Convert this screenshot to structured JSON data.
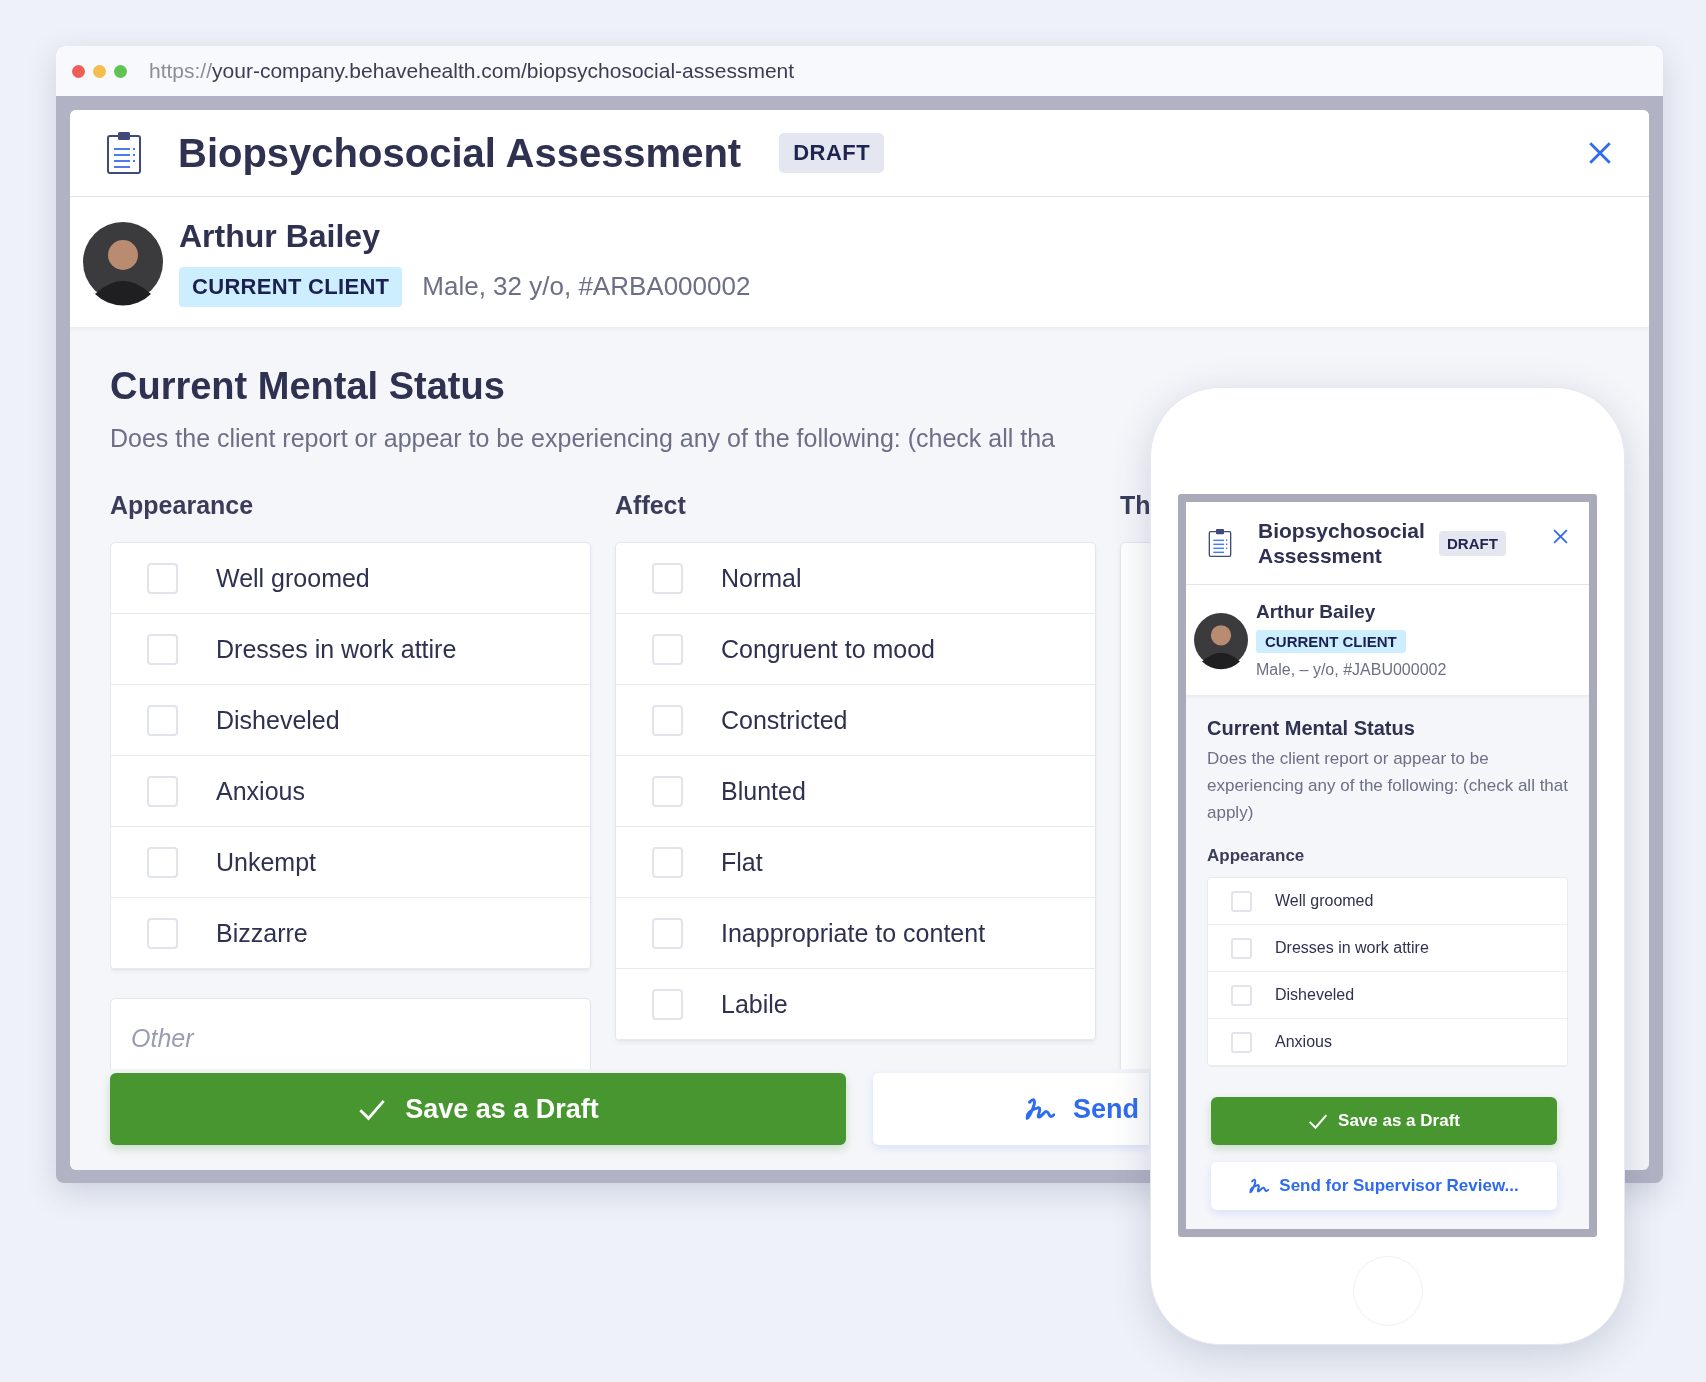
{
  "browser": {
    "url_scheme": "https://",
    "url_path": "your-company.behavehealth.com/biopsychosocial-assessment"
  },
  "desktop": {
    "title": "Biopsychosocial Assessment",
    "status_badge": "DRAFT",
    "client": {
      "name": "Arthur Bailey",
      "status": "CURRENT CLIENT",
      "meta": "Male, 32 y/o, #ARBA000002"
    },
    "section": {
      "title": "Current Mental Status",
      "description": "Does the client report or appear to be experiencing any of the following: (check all tha"
    },
    "columns": [
      {
        "heading": "Appearance",
        "other_placeholder": "Other",
        "items": [
          {
            "label": "Well groomed",
            "checked": false
          },
          {
            "label": "Dresses in work attire",
            "checked": false
          },
          {
            "label": "Disheveled",
            "checked": false
          },
          {
            "label": "Anxious",
            "checked": false
          },
          {
            "label": "Unkempt",
            "checked": false
          },
          {
            "label": "Bizzarre",
            "checked": false
          }
        ]
      },
      {
        "heading": "Affect",
        "items": [
          {
            "label": "Normal",
            "checked": false
          },
          {
            "label": "Congruent to mood",
            "checked": false
          },
          {
            "label": "Constricted",
            "checked": false
          },
          {
            "label": "Blunted",
            "checked": false
          },
          {
            "label": "Flat",
            "checked": false
          },
          {
            "label": "Inappropriate to content",
            "checked": false
          },
          {
            "label": "Labile",
            "checked": false
          }
        ]
      },
      {
        "heading": "Th"
      }
    ],
    "actions": [
      {
        "kind": "save",
        "label": "Save as a Draft"
      },
      {
        "kind": "send",
        "label": "Send"
      }
    ]
  },
  "mobile": {
    "title": "Biopsychosocial Assessment",
    "status_badge": "DRAFT",
    "client": {
      "name": "Arthur Bailey",
      "status": "CURRENT CLIENT",
      "meta": "Male, – y/o, #JABU000002"
    },
    "section": {
      "title": "Current Mental Status",
      "description": "Does the client report or appear to be experiencing any of the following: (check all that apply)"
    },
    "group": {
      "heading": "Appearance",
      "items": [
        {
          "label": "Well groomed",
          "checked": false
        },
        {
          "label": "Dresses in work attire",
          "checked": false
        },
        {
          "label": "Disheveled",
          "checked": false
        },
        {
          "label": "Anxious",
          "checked": false
        }
      ]
    },
    "actions": [
      {
        "kind": "save",
        "label": "Save as a Draft"
      },
      {
        "kind": "send",
        "label": "Send for Supervisor Review..."
      }
    ]
  }
}
